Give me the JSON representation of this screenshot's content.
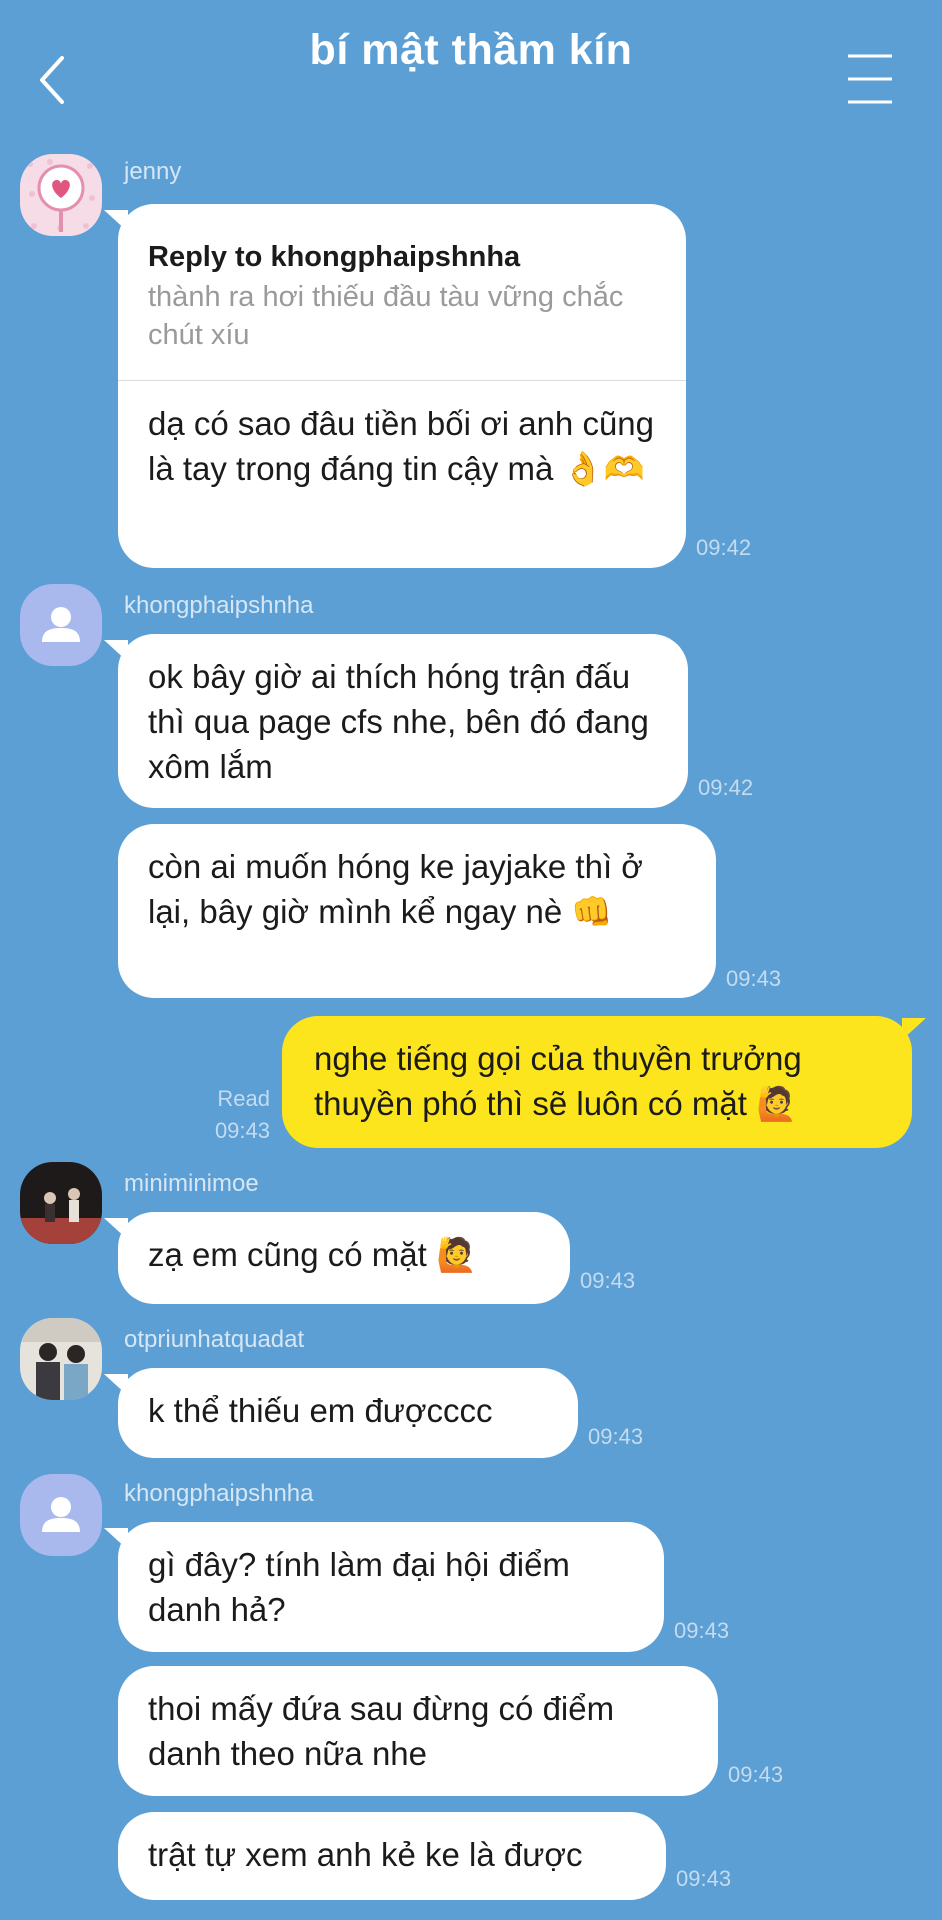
{
  "header": {
    "title": "bí mật thầm kín"
  },
  "messages": [
    {
      "sender": "jenny",
      "reply": {
        "title": "Reply to khongphaipshnha",
        "snippet": "thành ra hơi thiếu đầu tàu vững chắc chút xíu"
      },
      "text": "dạ có sao đâu tiền bối ơi anh cũng là tay trong đáng tin cậy mà 👌🫶",
      "time": "09:42"
    },
    {
      "sender": "khongphaipshnha",
      "text": "ok bây giờ ai thích hóng trận đấu thì qua page cfs nhe, bên đó đang xôm lắm",
      "time": "09:42"
    },
    {
      "text": "còn ai muốn hóng ke jayjake thì ở lại, bây giờ mình kể ngay nè 👊",
      "time": "09:43"
    },
    {
      "outgoing": true,
      "read": "Read",
      "text": "nghe tiếng gọi của thuyền trưởng thuyền phó thì sẽ luôn có mặt 🙋",
      "time": "09:43"
    },
    {
      "sender": "miniminimoe",
      "text": "zạ em cũng có mặt 🙋",
      "time": "09:43"
    },
    {
      "sender": "otpriunhatquadat",
      "text": "k thể thiếu em đượcccc",
      "time": "09:43"
    },
    {
      "sender": "khongphaipshnha",
      "text": "gì đây? tính làm đại hội điểm danh hả?",
      "time": "09:43"
    },
    {
      "text": "thoi mấy đứa sau đừng có điểm danh theo nữa nhe",
      "time": "09:43"
    },
    {
      "text": "trật tự xem anh kẻ ke là được",
      "time": "09:43"
    }
  ],
  "icons": {
    "back": "chevron-left-icon",
    "menu": "hamburger-menu-icon",
    "default_avatar": "default-user-avatar-icon"
  },
  "colors": {
    "background": "#5c9fd4",
    "incoming_bubble": "#ffffff",
    "outgoing_bubble": "#fde51d",
    "default_avatar": "#a9b9ee"
  }
}
